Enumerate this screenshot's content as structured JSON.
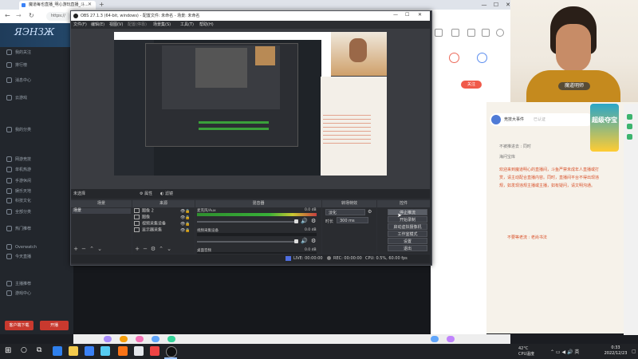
{
  "browser": {
    "tab_title": "魔道每也直播_明心游玩直播_斗...",
    "address": "https://",
    "win_min": "—",
    "win_max": "☐",
    "win_close": "✕"
  },
  "site": {
    "logo": "ЯЭНЗЖ",
    "sidebar": [
      "我的关注",
      "排行榜",
      "消息中心",
      "云游戏",
      "我的分类",
      "网游竞技",
      "单机热游",
      "手游休闲",
      "娱乐天地",
      "科技文化",
      "全部分类",
      "热门推荐",
      "Overwatch",
      "今天直播",
      "主播推荐",
      "游戏中心"
    ],
    "sidebar_btn_1": "客户端下载",
    "sidebar_btn_2": "开播",
    "follow": "关注"
  },
  "cam": {
    "tag": "魔道明师"
  },
  "chat": {
    "room_name": "竞技大事件",
    "verified": "已认证",
    "banner": "超级夺宝",
    "lines": [
      "不被推进去 : 同时",
      "海问宝库"
    ],
    "notice": "欢迎来到魔道明心的直播间，斗鱼严禁未成年人直播或打赏，请主动配合直播内容。同时，直播间平台不得出现违规，如发现违规主播或主播，如有疑问，请文明沟通。",
    "user_line": "不要等老流 : 老尚书法"
  },
  "obs": {
    "title": "OBS 27.1.3 (64-bit, windows) - 配置文件: 未命名 - 场景: 未命名",
    "menu": [
      "文件(F)",
      "编辑(E)",
      "视图(V)",
      "配置(停靠)",
      "场景集(S)",
      "工具(T)",
      "帮助(H)"
    ],
    "scene_label": "未选择",
    "props_btn": "属性",
    "filters_btn": "滤镜",
    "docks": {
      "scenes": "场景",
      "sources": "来源",
      "mixer": "混音器",
      "transitions": "转场特效",
      "controls": "控件"
    },
    "scenes": [
      "场景"
    ],
    "sources": [
      "图像 2",
      "图像",
      "视频采集设备",
      "显示器采集"
    ],
    "mixer": [
      {
        "name": "麦克风/Aux",
        "db": "0.0 dB"
      },
      {
        "name": "视频采集设备",
        "db": "0.0 dB"
      },
      {
        "name": "桌面音频",
        "db": "0.0 dB"
      }
    ],
    "transition_value": "淡化",
    "duration_label": "时长",
    "duration_value": "300 ms",
    "controls": [
      "停止推流",
      "开始录制",
      "启动虚拟摄像机",
      "工作室模式",
      "设置",
      "退出"
    ],
    "status": {
      "live": "LIVE: 00:00:00",
      "rec": "REC: 00:00:00",
      "cpu": "CPU: 0.5%, 60.00 fps"
    }
  },
  "taskbar": {
    "weather": "42°C",
    "weather_sub": "CPU温度",
    "time": "0:33",
    "date": "2022/12/23"
  }
}
